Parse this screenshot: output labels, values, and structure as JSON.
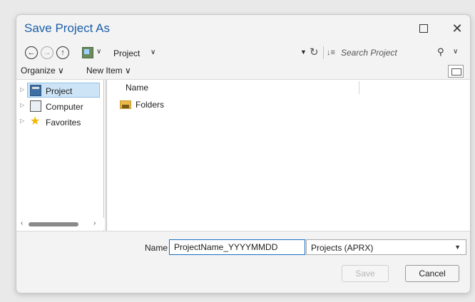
{
  "window": {
    "title": "Save Project As"
  },
  "nav": {
    "back_icon": "arrow-left-circle",
    "forward_icon": "arrow-right-circle",
    "up_icon": "arrow-up-circle",
    "location": "Project",
    "search_placeholder": "Search Project"
  },
  "toolbar": {
    "organize": "Organize ∨",
    "new_item": "New Item ∨"
  },
  "tree": {
    "items": [
      {
        "label": "Project",
        "icon": "project-icon",
        "selected": true
      },
      {
        "label": "Computer",
        "icon": "computer-icon",
        "selected": false
      },
      {
        "label": "Favorites",
        "icon": "star-icon",
        "selected": false
      }
    ]
  },
  "list": {
    "column_name": "Name",
    "rows": [
      {
        "label": "Folders",
        "icon": "folder-icon"
      }
    ]
  },
  "footer": {
    "name_label": "Name",
    "name_value": "ProjectName_YYYYMMDD",
    "type_value": "Projects (APRX)",
    "save_label": "Save",
    "cancel_label": "Cancel"
  },
  "colors": {
    "title": "#1a5ea8",
    "selection": "#cde4f7",
    "input_border": "#1a6fc1"
  }
}
